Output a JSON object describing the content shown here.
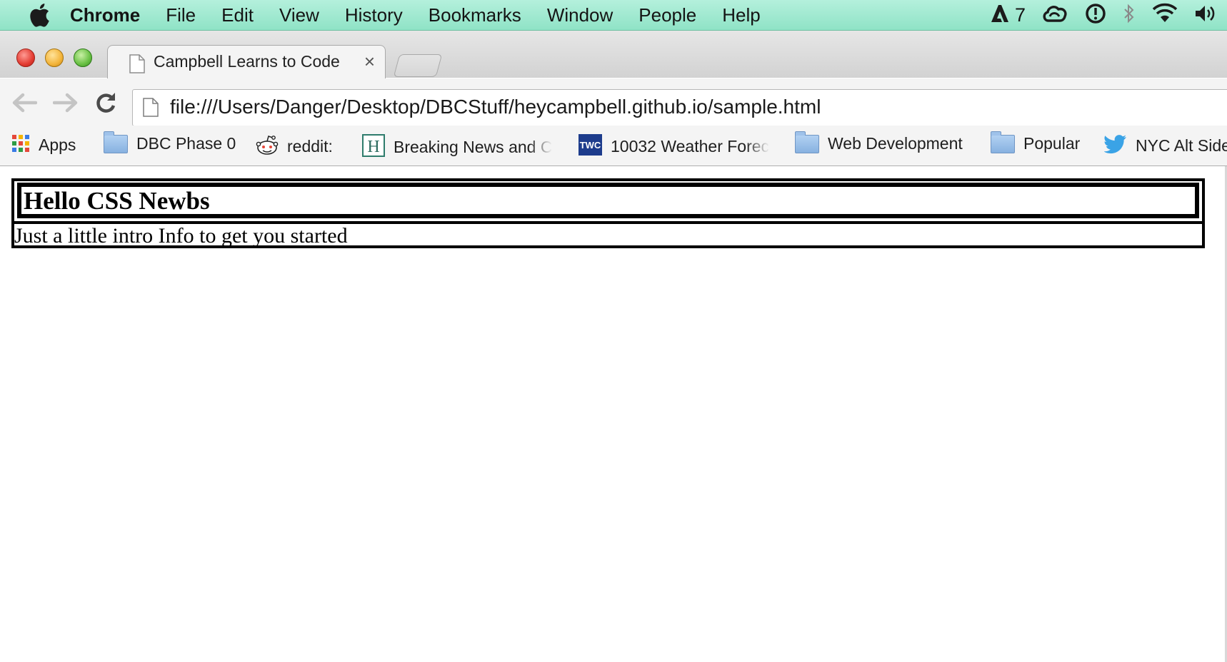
{
  "menubar": {
    "app_name": "Chrome",
    "items": [
      "File",
      "Edit",
      "View",
      "History",
      "Bookmarks",
      "Window",
      "People",
      "Help"
    ],
    "status": {
      "adobe_count": "7"
    }
  },
  "tabs": [
    {
      "title": "Campbell Learns to Code",
      "active": true
    }
  ],
  "toolbar": {
    "url": "file:///Users/Danger/Desktop/DBCStuff/heycampbell.github.io/sample.html"
  },
  "bookmarks": [
    {
      "label": "Apps",
      "icon": "apps-grid-icon"
    },
    {
      "label": "DBC Phase 0",
      "icon": "folder-icon"
    },
    {
      "label": "reddit:",
      "icon": "reddit-icon"
    },
    {
      "label": "Breaking News and C",
      "icon": "huffpost-icon"
    },
    {
      "label": "10032 Weather Forec",
      "icon": "twc-icon"
    },
    {
      "label": "Web Development",
      "icon": "folder-icon"
    },
    {
      "label": "Popular",
      "icon": "folder-icon"
    },
    {
      "label": "NYC Alt Side",
      "icon": "twitter-icon"
    }
  ],
  "page": {
    "heading": "Hello CSS Newbs",
    "intro": "Just a little intro Info to get you started"
  }
}
